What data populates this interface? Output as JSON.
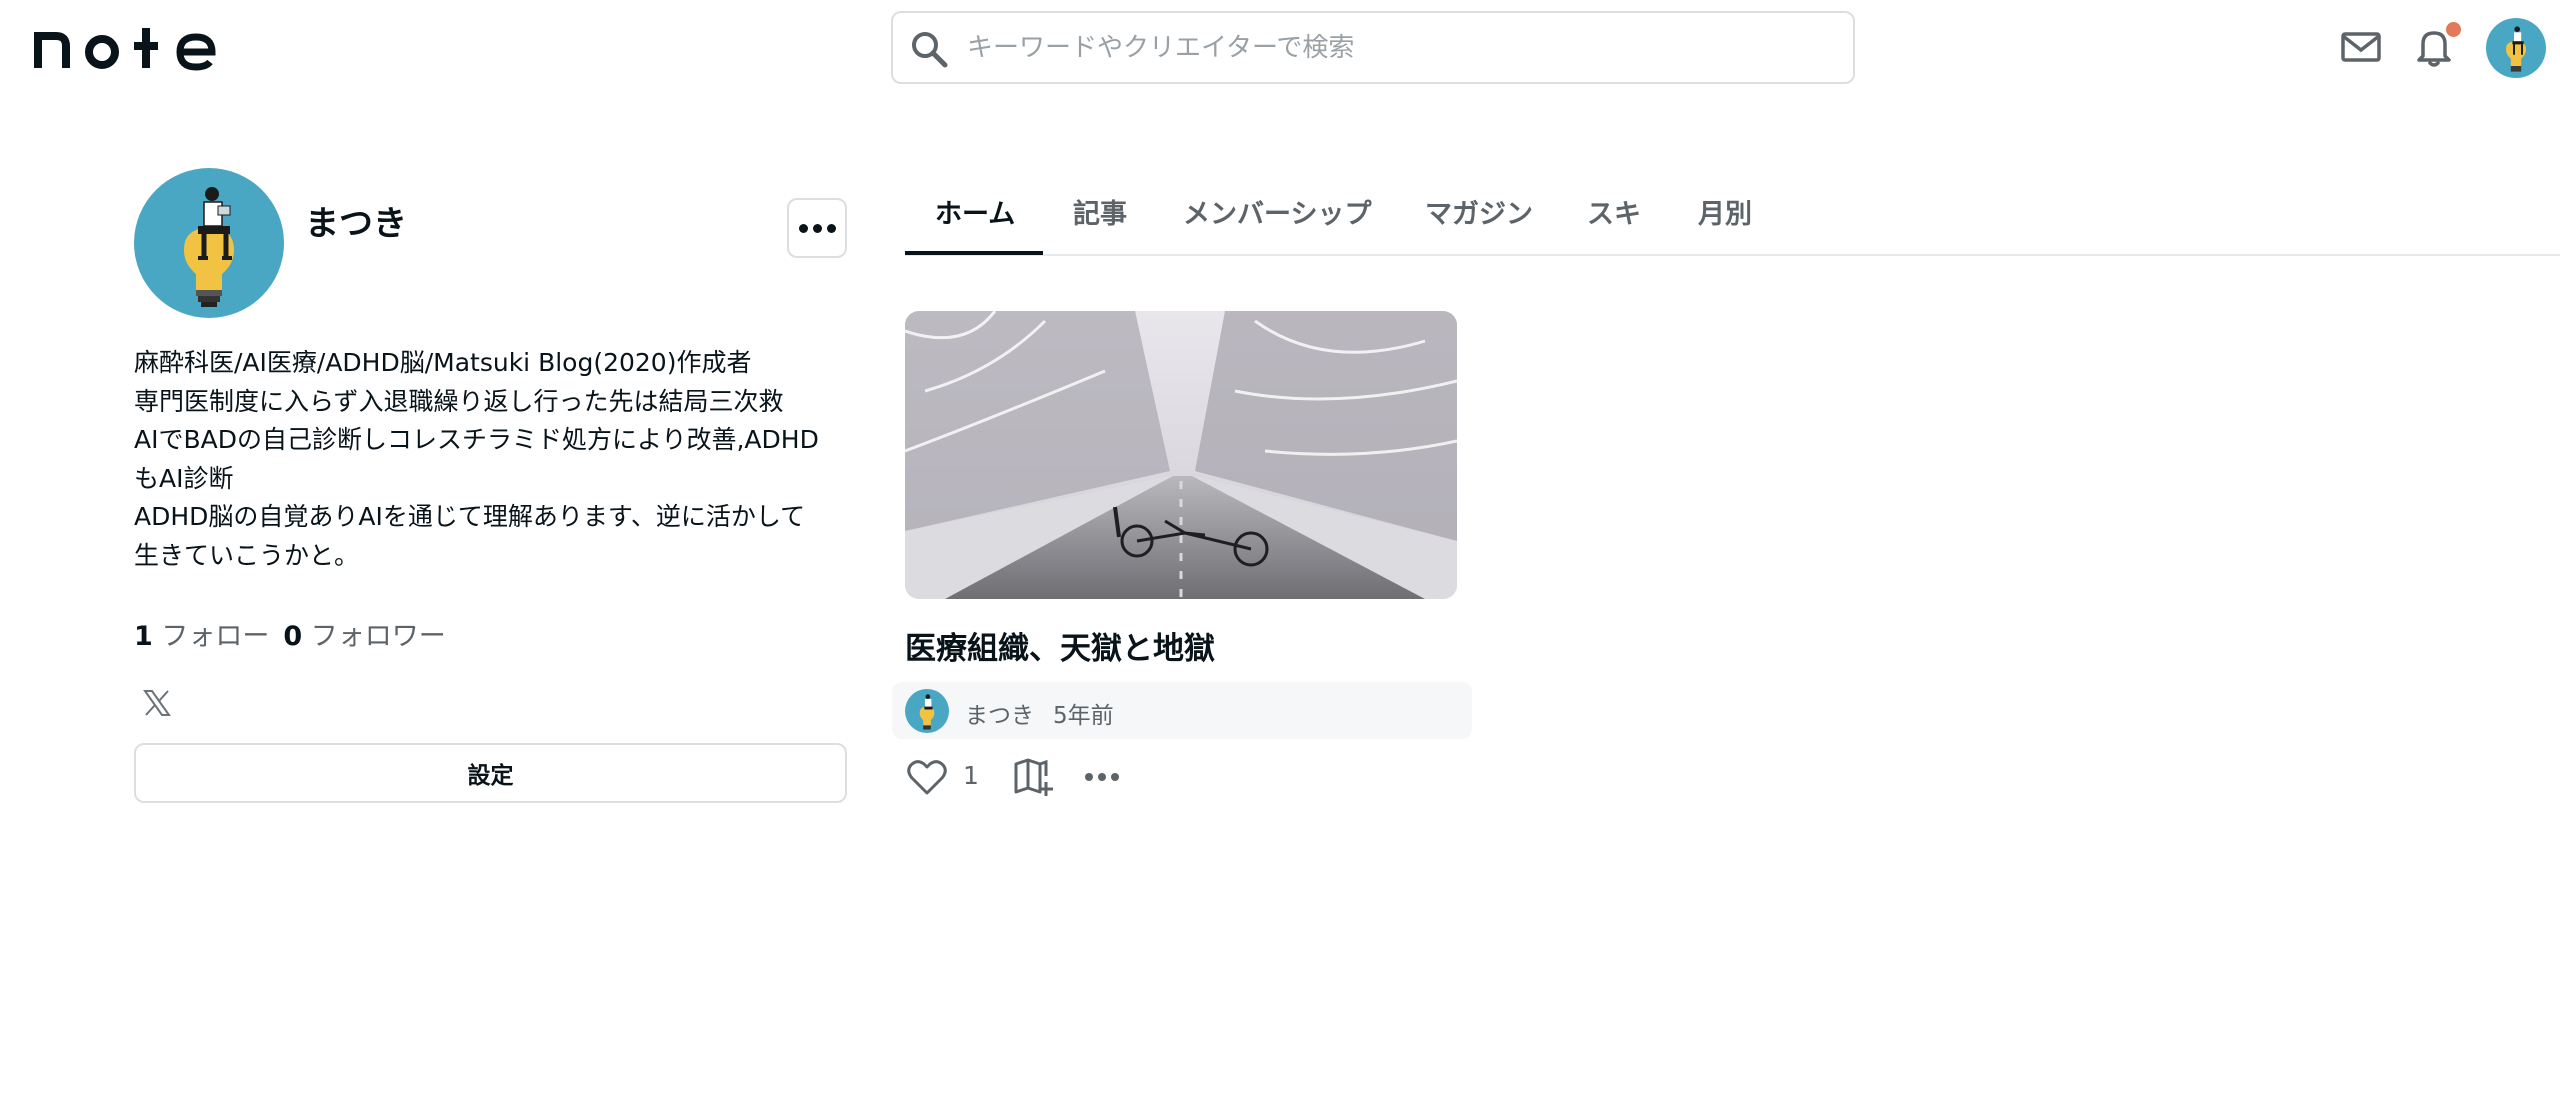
{
  "header": {
    "logo_text": "note",
    "search_placeholder": "キーワードやクリエイターで検索",
    "notification_color": "#e07a5a"
  },
  "profile": {
    "name": "まつき",
    "bio_lines": [
      "麻酔科医/AI医療/ADHD脳/Matsuki Blog(2020)作成者",
      "専門医制度に入らず入退職繰り返し行った先は結局三次救",
      "AIでBADの自己診断しコレスチラミド処方により改善,ADHD",
      "もAI診断",
      "ADHD脳の自覚ありAIを通じて理解あります、逆に活かして",
      "生きていこうかと。"
    ],
    "following_count": "1",
    "following_label": "フォロー",
    "followers_count": "0",
    "followers_label": "フォロワー",
    "settings_label": "設定"
  },
  "tabs": [
    {
      "label": "ホーム",
      "active": true
    },
    {
      "label": "記事",
      "active": false
    },
    {
      "label": "メンバーシップ",
      "active": false
    },
    {
      "label": "マガジン",
      "active": false
    },
    {
      "label": "スキ",
      "active": false
    },
    {
      "label": "月別",
      "active": false
    }
  ],
  "article": {
    "title": "医療組織、天獄と地獄",
    "author": "まつき",
    "time": "5年前",
    "likes": "1"
  },
  "colors": {
    "avatar_bg": "#4aa7c3",
    "text": "#08131a",
    "muted": "#5d6469"
  }
}
